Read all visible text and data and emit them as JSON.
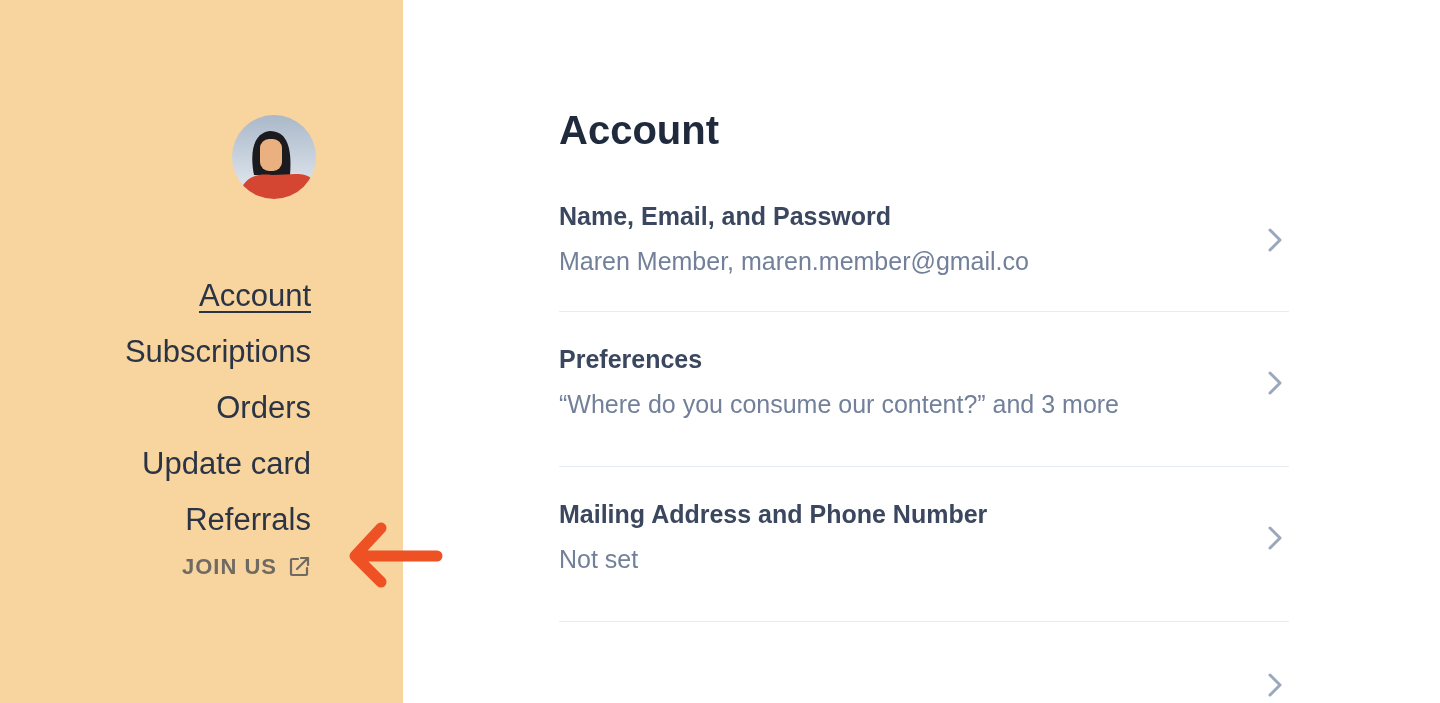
{
  "sidebar": {
    "items": [
      {
        "label": "Account",
        "selected": true
      },
      {
        "label": "Subscriptions",
        "selected": false
      },
      {
        "label": "Orders",
        "selected": false
      },
      {
        "label": "Update card",
        "selected": false
      },
      {
        "label": "Referrals",
        "selected": false
      }
    ],
    "join_link": {
      "label": "JOIN US"
    }
  },
  "main": {
    "heading": "Account",
    "rows": [
      {
        "title": "Name, Email, and Password",
        "subtitle": "Maren Member, maren.member@gmail.co"
      },
      {
        "title": "Preferences",
        "subtitle": "“Where do you consume our content?” and 3 more"
      },
      {
        "title": "Mailing Address and Phone Number",
        "subtitle": "Not set"
      },
      {}
    ]
  }
}
